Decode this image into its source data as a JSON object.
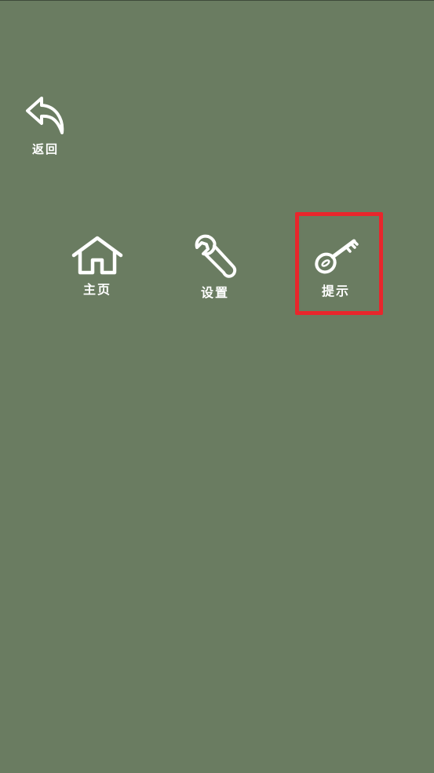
{
  "nav": {
    "back_label": "返回",
    "home_label": "主页",
    "settings_label": "设置",
    "hint_label": "提示"
  },
  "icons": {
    "back": "undo-arrow-icon",
    "home": "house-icon",
    "settings": "wrench-icon",
    "hint": "key-icon"
  },
  "colors": {
    "background": "#6a7c61",
    "foreground": "#ffffff",
    "highlight": "#e8262c"
  }
}
